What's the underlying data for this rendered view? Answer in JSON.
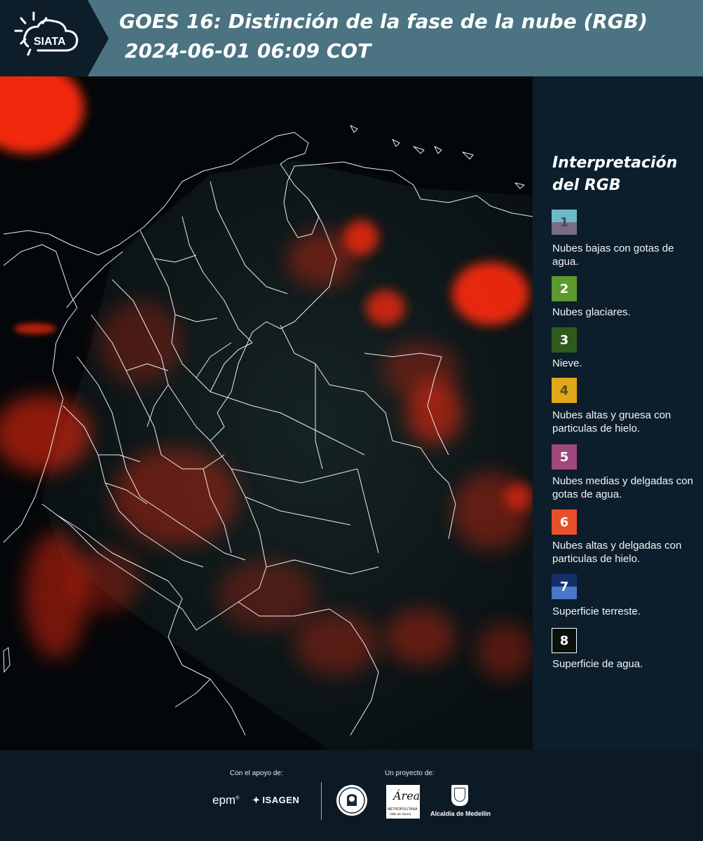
{
  "header": {
    "logo_text": "SIATA",
    "title_line1": "GOES 16: Distinción de la fase de la nube (RGB)",
    "title_line2": "2024-06-01 06:09 COT"
  },
  "legend": {
    "title": "Interpretación del RGB",
    "items": [
      {
        "number": "1",
        "label": "Nubes bajas con gotas de agua.",
        "color_top": "#6cbac9",
        "color_bottom": "#7a6b88",
        "text_color": "#4a4a55"
      },
      {
        "number": "2",
        "label": "Nubes glaciares.",
        "color_top": "#5c9a2e",
        "color_bottom": "#5c9a2e",
        "text_color": "#ffffff"
      },
      {
        "number": "3",
        "label": "Nieve.",
        "color_top": "#2e5a1c",
        "color_bottom": "#2e5a1c",
        "text_color": "#ffffff"
      },
      {
        "number": "4",
        "label": "Nubes altas y gruesa con particulas de hielo.",
        "color_top": "#e0a81a",
        "color_bottom": "#e0a81a",
        "text_color": "#5a4a20"
      },
      {
        "number": "5",
        "label": "Nubes medias y delgadas con gotas de agua.",
        "color_top": "#a1487c",
        "color_bottom": "#a1487c",
        "text_color": "#ffffff"
      },
      {
        "number": "6",
        "label": "Nubes altas y delgadas con particulas de hielo.",
        "color_top": "#e8502a",
        "color_bottom": "#e8502a",
        "text_color": "#ffffff"
      },
      {
        "number": "7",
        "label": "Superficie terreste.",
        "color_top": "#14306a",
        "color_bottom": "#4a78c8",
        "text_color": "#ffffff"
      },
      {
        "number": "8",
        "label": "Superficie de agua.",
        "color_top": "#0a100c",
        "color_bottom": "#0a100c",
        "text_color": "#ffffff"
      }
    ]
  },
  "footer": {
    "support_caption": "Con el apoyo de:",
    "project_caption": "Un proyecto de:",
    "sponsor_epm": "epm",
    "sponsor_isagen": "ISAGEN",
    "area_text": "Área",
    "area_subtext": "METROPOLITANA",
    "area_subtext2": "Valle de Aburrá",
    "alcaldia_text": "Alcaldía de Medellín"
  },
  "colors": {
    "header_bg": "#4b7382",
    "legend_bg": "#0c1e2b",
    "map_bg": "#05080b",
    "cloud_red": "#ff2a10"
  }
}
